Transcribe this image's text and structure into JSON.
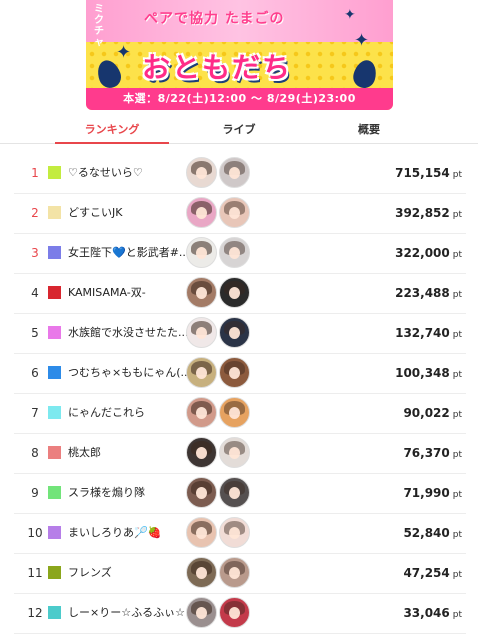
{
  "banner": {
    "small_label": "ミクチャ",
    "title_line1": "ペアで協力 たまごの",
    "title_line2": "おともだち",
    "period": "本選：8/22(土)12:00 〜 8/29(土)23:00"
  },
  "tabs": [
    {
      "label": "ランキング",
      "active": true
    },
    {
      "label": "ライブ",
      "active": false
    },
    {
      "label": "概要",
      "active": false
    }
  ],
  "ranking": [
    {
      "rank": "1",
      "name": "♡るなせいら♡",
      "color": "#c3ec3f",
      "score": "715,154",
      "unit": "pt"
    },
    {
      "rank": "2",
      "name": "どすこいJK",
      "color": "#f3e3a6",
      "score": "392,852",
      "unit": "pt"
    },
    {
      "rank": "3",
      "name": "女王陛下💙と影武者#...",
      "color": "#7b7de8",
      "score": "322,000",
      "unit": "pt"
    },
    {
      "rank": "4",
      "name": "KAMISAMA-双-",
      "color": "#d8262f",
      "score": "223,488",
      "unit": "pt"
    },
    {
      "rank": "5",
      "name": "水族館で水没させたた...",
      "color": "#e978e9",
      "score": "132,740",
      "unit": "pt"
    },
    {
      "rank": "6",
      "name": "つむちゃ×ももにゃん(...",
      "color": "#2d8be8",
      "score": "100,348",
      "unit": "pt"
    },
    {
      "rank": "7",
      "name": "にゃんだこれら",
      "color": "#7de9ef",
      "score": "90,022",
      "unit": "pt"
    },
    {
      "rank": "8",
      "name": "桃太郎",
      "color": "#eb7f7f",
      "score": "76,370",
      "unit": "pt"
    },
    {
      "rank": "9",
      "name": "スラ様を煽り隊",
      "color": "#72e47a",
      "score": "71,990",
      "unit": "pt"
    },
    {
      "rank": "10",
      "name": "まいしろりあ🏸🍓",
      "color": "#b67ee8",
      "score": "52,840",
      "unit": "pt"
    },
    {
      "rank": "11",
      "name": "フレンズ",
      "color": "#8ba61c",
      "score": "47,254",
      "unit": "pt"
    },
    {
      "rank": "12",
      "name": "しー×りー☆ふるふぃ☆",
      "color": "#4ccbcb",
      "score": "33,046",
      "unit": "pt"
    }
  ],
  "avatar_tones": [
    [
      "#e8d9d2",
      "#cfc8c8"
    ],
    [
      "#e9a7c5",
      "#e8c6b8"
    ],
    [
      "#ecebe8",
      "#d7d4d4"
    ],
    [
      "#a37b66",
      "#2b2b2b"
    ],
    [
      "#f0e8e8",
      "#2b3447"
    ],
    [
      "#c7b07e",
      "#8c5a3d"
    ],
    [
      "#d19a8a",
      "#e6a260"
    ],
    [
      "#3d3533",
      "#e3dcd8"
    ],
    [
      "#7c5c50",
      "#555050"
    ],
    [
      "#e8c3b0",
      "#f1dcd6"
    ],
    [
      "#7d6a55",
      "#b99a8c"
    ],
    [
      "#9a8f8f",
      "#c33a4a"
    ]
  ]
}
